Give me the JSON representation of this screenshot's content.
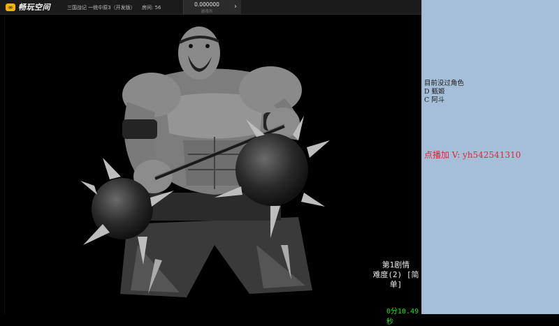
{
  "topbar": {
    "logo_text": "畅玩空间",
    "game_title": "三国战记 一统中原3（开发版）",
    "room": "房间: 56",
    "coin_value": "0.000000",
    "coin_label": "游戏币",
    "arrow_icon": "chevron-right-icon"
  },
  "game": {
    "story_line1": "第1剧情",
    "story_line2": "难度(2) [简单]",
    "timer": "0分10.49秒"
  },
  "panel": {
    "line1": "目前没过角色",
    "line2": "D 甄姬",
    "line3": "C 阿斗",
    "promo": "点播加 V: yh542541310"
  },
  "colors": {
    "panel_bg": "#a5bfd9",
    "promo": "#e0243a",
    "timer": "#22dd22",
    "logo_accent": "#f2b200"
  }
}
